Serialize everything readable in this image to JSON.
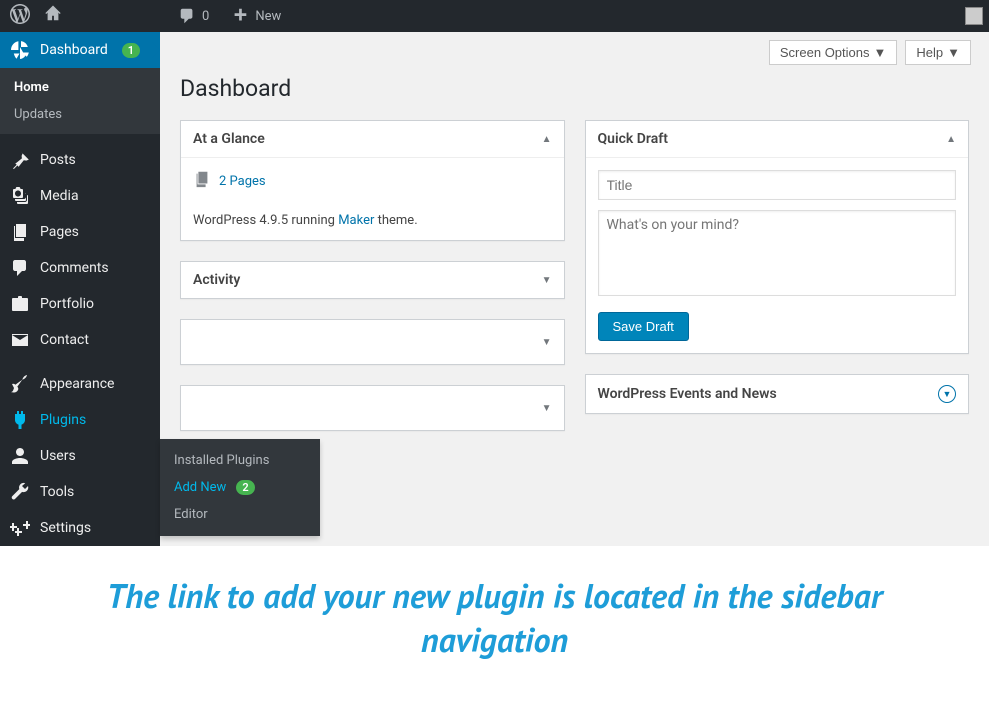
{
  "topbar": {
    "comment_count": "0",
    "new_label": "New"
  },
  "sidebar": {
    "dashboard": {
      "label": "Dashboard",
      "badge": "1"
    },
    "submenu": {
      "home": "Home",
      "updates": "Updates"
    },
    "items": [
      {
        "label": "Posts"
      },
      {
        "label": "Media"
      },
      {
        "label": "Pages"
      },
      {
        "label": "Comments"
      },
      {
        "label": "Portfolio"
      },
      {
        "label": "Contact"
      }
    ],
    "items2": [
      {
        "label": "Appearance"
      },
      {
        "label": "Plugins"
      },
      {
        "label": "Users"
      },
      {
        "label": "Tools"
      },
      {
        "label": "Settings"
      }
    ]
  },
  "flyout": {
    "installed": "Installed Plugins",
    "add_new": "Add New",
    "add_new_badge": "2",
    "editor": "Editor"
  },
  "header": {
    "screen_options": "Screen Options",
    "help": "Help"
  },
  "page_title": "Dashboard",
  "glance": {
    "title": "At a Glance",
    "pages": "2 Pages",
    "version_prefix": "WordPress 4.9.5 running ",
    "theme": "Maker",
    "version_suffix": " theme."
  },
  "activity": {
    "title": "Activity"
  },
  "quickdraft": {
    "title": "Quick Draft",
    "title_placeholder": "Title",
    "body_placeholder": "What's on your mind?",
    "save": "Save Draft"
  },
  "news": {
    "title": "WordPress Events and News"
  },
  "caption": "The link to add your new plugin is located in the sidebar navigation"
}
